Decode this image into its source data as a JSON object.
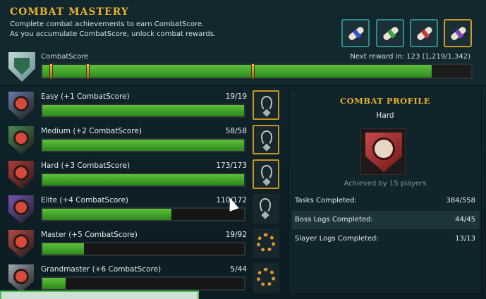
{
  "header": {
    "title": "COMBAT MASTERY",
    "description_line1": "Complete combat achievements to earn CombatScore.",
    "description_line2": "As you accumulate CombatScore, unlock combat rewards.",
    "score_label": "CombatScore",
    "next_reward_text": "Next reward in: 123 (1,219/1,342)",
    "score_current": 1219,
    "score_max": 1342,
    "rewards": [
      {
        "icon": "scroll-blue-icon",
        "ribbon_color": "#2f54c7",
        "selected": false
      },
      {
        "icon": "scroll-green-icon",
        "ribbon_color": "#3fa24a",
        "selected": false
      },
      {
        "icon": "scroll-red-icon",
        "ribbon_color": "#c23a3a",
        "selected": false
      },
      {
        "icon": "scroll-purple-icon",
        "ribbon_color": "#8a3fc2",
        "selected": true
      }
    ]
  },
  "tiers": [
    {
      "name": "Easy (+1 CombatScore)",
      "count": "19/19",
      "completed": 19,
      "total": 19,
      "shield_color": "#6a7ba8",
      "reward_icon": "amulet-icon",
      "claimed": true
    },
    {
      "name": "Medium (+2 CombatScore)",
      "count": "58/58",
      "completed": 58,
      "total": 58,
      "shield_color": "#4c8a4f",
      "reward_icon": "amulet-icon",
      "claimed": true
    },
    {
      "name": "Hard (+3 CombatScore)",
      "count": "173/173",
      "completed": 173,
      "total": 173,
      "shield_color": "#b43a3a",
      "reward_icon": "amulet-icon",
      "claimed": true
    },
    {
      "name": "Elite (+4 CombatScore)",
      "count": "110/172",
      "completed": 110,
      "total": 172,
      "shield_color": "#7a55b0",
      "reward_icon": "amulet-icon",
      "claimed": false
    },
    {
      "name": "Master (+5 CombatScore)",
      "count": "19/92",
      "completed": 19,
      "total": 92,
      "shield_color": "#b44a46",
      "reward_icon": "ring-icon",
      "claimed": false
    },
    {
      "name": "Grandmaster (+6 CombatScore)",
      "count": "5/44",
      "completed": 5,
      "total": 44,
      "shield_color": "#a0a8b0",
      "reward_icon": "ring-icon",
      "claimed": false
    }
  ],
  "profile": {
    "title": "COMBAT PROFILE",
    "tier": "Hard",
    "achieved_by": "Achieved by 15 players",
    "stats": [
      {
        "label": "Tasks Completed:",
        "value": "384/558"
      },
      {
        "label": "Boss Logs Completed:",
        "value": "44/45"
      },
      {
        "label": "Slayer Logs Completed:",
        "value": "13/13"
      }
    ]
  }
}
